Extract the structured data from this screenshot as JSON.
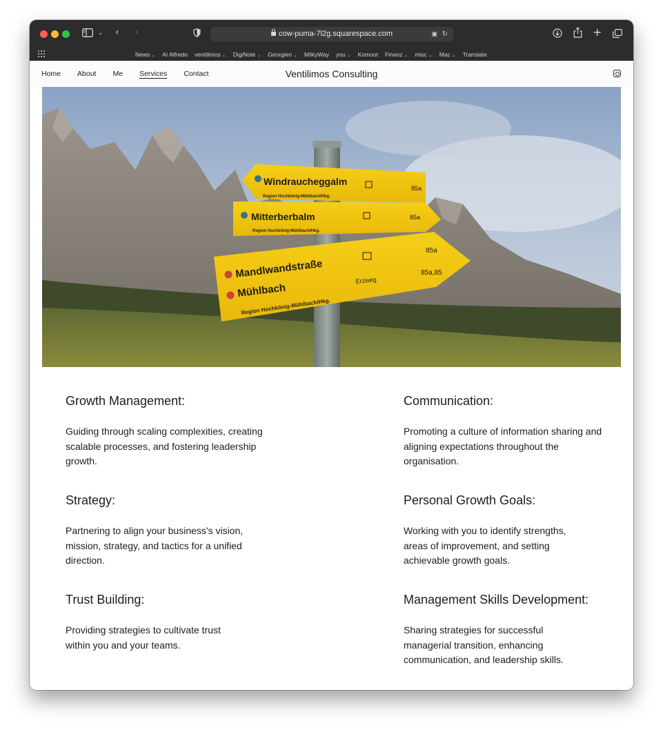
{
  "browser": {
    "url": "cow-puma-7l2g.squarespace.com",
    "bookmarks": [
      {
        "label": "News",
        "menu": true
      },
      {
        "label": "AI Alfredo",
        "menu": false
      },
      {
        "label": "ventilimos",
        "menu": true
      },
      {
        "label": "DigiNote",
        "menu": true
      },
      {
        "label": "Georgien",
        "menu": true
      },
      {
        "label": "MilkyWay",
        "menu": false
      },
      {
        "label": "you",
        "menu": true
      },
      {
        "label": "Komoot",
        "menu": false
      },
      {
        "label": "Finanz",
        "menu": true
      },
      {
        "label": "misc",
        "menu": true
      },
      {
        "label": "Mac",
        "menu": true
      },
      {
        "label": "Translate",
        "menu": false
      }
    ]
  },
  "site": {
    "title": "Ventilimos Consulting",
    "nav": [
      {
        "label": "Home",
        "active": false
      },
      {
        "label": "About",
        "active": false
      },
      {
        "label": "Me",
        "active": false
      },
      {
        "label": "Services",
        "active": true
      },
      {
        "label": "Contact",
        "active": false
      }
    ]
  },
  "hero": {
    "signs": [
      {
        "text": "Windraucheggalm",
        "sub": "Region Hochkönig-Mühlbach/Hkg.",
        "code": "85a",
        "dot": "#3c6f8e"
      },
      {
        "text": "Mitterberbalm",
        "sub": "Region Hochkönig-Mühlbach/Hkg.",
        "code": "85a",
        "dot": "#3c6f8e"
      },
      {
        "text": "Mandlwandstraße",
        "text2": "Mühlbach",
        "sub": "Region Hochkönig-Mühlbach/Hkg.",
        "code": "85a",
        "code2": "85a,85",
        "note": "Erzweg",
        "dot": "#c9433e"
      }
    ]
  },
  "services": {
    "left": [
      {
        "title": "Growth Management:",
        "desc": "Guiding through scaling complexities, creating scalable processes, and fostering leadership growth."
      },
      {
        "title": "Strategy:",
        "desc": "Partnering to align your business's vision, mission, strategy, and tactics for a unified direction."
      },
      {
        "title": "Trust Building:",
        "desc": "Providing strategies to cultivate trust within you and your teams."
      }
    ],
    "right": [
      {
        "title": "Communication:",
        "desc": "Promoting a culture of information sharing and aligning expectations throughout the organisation."
      },
      {
        "title": "Personal Growth Goals:",
        "desc": "Working with you to identify strengths, areas of improvement, and setting achievable growth goals."
      },
      {
        "title": "Management Skills Development:",
        "desc": "Sharing strategies for successful managerial transition, enhancing communication, and leadership skills."
      }
    ]
  }
}
